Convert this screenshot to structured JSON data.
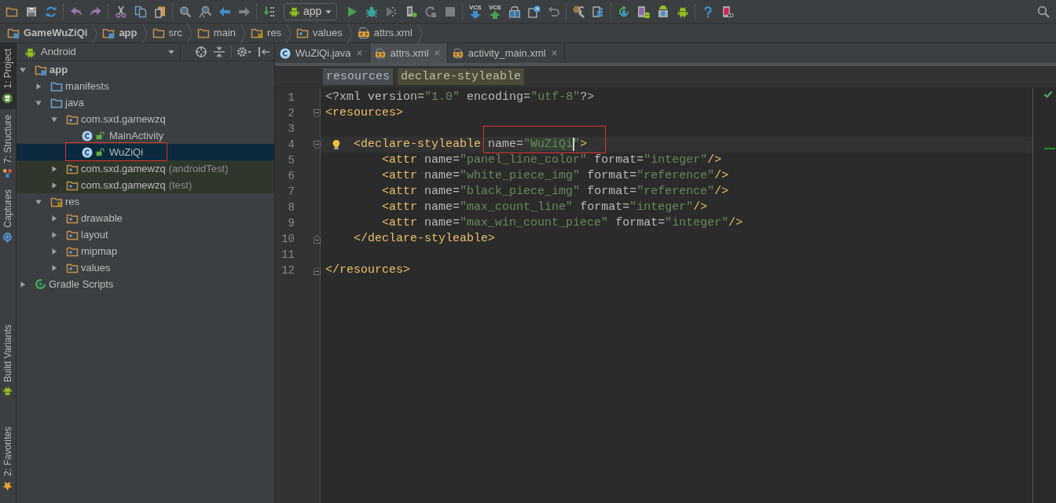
{
  "toolbar": {
    "run_configuration": "app",
    "vcs_buttons": [
      {
        "label": "VCS",
        "kind": "update"
      },
      {
        "label": "VCS",
        "kind": "commit"
      }
    ]
  },
  "navigation_bar": [
    {
      "label": "GameWuZiQi",
      "kind": "module"
    },
    {
      "label": "app",
      "kind": "module"
    },
    {
      "label": "src",
      "kind": "folder"
    },
    {
      "label": "main",
      "kind": "folder"
    },
    {
      "label": "res",
      "kind": "res-folder"
    },
    {
      "label": "values",
      "kind": "package"
    },
    {
      "label": "attrs.xml",
      "kind": "xml-file"
    }
  ],
  "tool_windows": {
    "top": [
      {
        "label": "1: Project",
        "kind": "android-badge",
        "selected": true
      },
      {
        "label": "7: Structure",
        "kind": "structure",
        "selected": false
      },
      {
        "label": "Captures",
        "kind": "captures",
        "selected": false
      }
    ],
    "bottom": [
      {
        "label": "Build Variants",
        "kind": "android",
        "selected": false
      },
      {
        "label": "2: Favorites",
        "kind": "star",
        "selected": false
      }
    ]
  },
  "project_panel": {
    "view": "Android",
    "tree": [
      {
        "label": "app",
        "kind": "module",
        "expanded": true,
        "selected": false,
        "children": [
          {
            "label": "manifests",
            "kind": "source-folder",
            "expanded": false,
            "selected": false
          },
          {
            "label": "java",
            "kind": "source-folder",
            "expanded": true,
            "selected": false,
            "children": [
              {
                "label": "com.sxd.gamewzq",
                "kind": "package",
                "expanded": true,
                "selected": false,
                "children": [
                  {
                    "label": "MainActivity",
                    "kind": "class",
                    "selected": false
                  },
                  {
                    "label": "WuZiQi",
                    "kind": "class",
                    "selected": true,
                    "annotated": true
                  }
                ]
              },
              {
                "label": "com.sxd.gamewzq",
                "suffix": "(androidTest)",
                "kind": "test-package",
                "expanded": false,
                "selected": false
              },
              {
                "label": "com.sxd.gamewzq",
                "suffix": "(test)",
                "kind": "test-package",
                "expanded": false,
                "selected": false
              }
            ]
          },
          {
            "label": "res",
            "kind": "res-folder",
            "expanded": true,
            "selected": false,
            "children": [
              {
                "label": "drawable",
                "kind": "package",
                "expanded": false,
                "selected": false
              },
              {
                "label": "layout",
                "kind": "package",
                "expanded": false,
                "selected": false
              },
              {
                "label": "mipmap",
                "kind": "package",
                "expanded": false,
                "selected": false
              },
              {
                "label": "values",
                "kind": "package",
                "expanded": false,
                "selected": false
              }
            ]
          }
        ]
      },
      {
        "label": "Gradle Scripts",
        "kind": "gradle",
        "expanded": false,
        "selected": false
      }
    ]
  },
  "editor": {
    "tabs": [
      {
        "label": "WuZiQi.java",
        "kind": "class",
        "selected": false
      },
      {
        "label": "attrs.xml",
        "kind": "xml",
        "selected": true
      },
      {
        "label": "activity_main.xml",
        "kind": "xml",
        "selected": false
      }
    ],
    "breadcrumbs": [
      {
        "label": "resources",
        "selected": false
      },
      {
        "label": "declare-styleable",
        "selected": true
      }
    ],
    "lines": [
      {
        "number": "1",
        "kind": "plain",
        "text": "<?xml version=\"1.0\" encoding=\"utf-8\"?>"
      },
      {
        "number": "2",
        "kind": "fold-start",
        "text": "<resources>"
      },
      {
        "number": "3",
        "kind": "plain"
      },
      {
        "number": "4",
        "kind": "fold-start",
        "text": "    <declare-styleable name=\"WuZiQi\">",
        "current": true,
        "intention": true,
        "annotated": true
      },
      {
        "number": "5",
        "kind": "plain",
        "text": "        <attr name=\"panel_line_color\" format=\"integer\"/>"
      },
      {
        "number": "6",
        "kind": "plain",
        "text": "        <attr name=\"white_piece_img\" format=\"reference\"/>"
      },
      {
        "number": "7",
        "kind": "plain",
        "text": "        <attr name=\"black_piece_img\" format=\"reference\"/>"
      },
      {
        "number": "8",
        "kind": "plain",
        "text": "        <attr name=\"max_count_line\" format=\"integer\"/>"
      },
      {
        "number": "9",
        "kind": "plain",
        "text": "        <attr name=\"max_win_count_piece\" format=\"integer\"/>"
      },
      {
        "number": "10",
        "kind": "fold-end",
        "text": "    </declare-styleable>"
      },
      {
        "number": "11",
        "kind": "plain"
      },
      {
        "number": "12",
        "kind": "fold-end",
        "text": "</resources>"
      }
    ]
  }
}
